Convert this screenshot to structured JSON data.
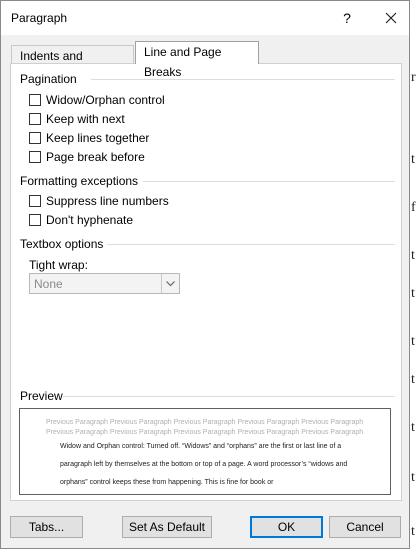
{
  "window": {
    "title": "Paragraph",
    "help_glyph": "?",
    "close_glyph": "✕"
  },
  "tabs": [
    {
      "label": "Indents and Spacing",
      "active": false
    },
    {
      "label": "Line and Page Breaks",
      "active": true
    }
  ],
  "pagination": {
    "heading": "Pagination",
    "options": [
      {
        "label": "Widow/Orphan control",
        "checked": false
      },
      {
        "label": "Keep with next",
        "checked": false
      },
      {
        "label": "Keep lines together",
        "checked": false
      },
      {
        "label": "Page break before",
        "checked": false
      }
    ]
  },
  "formatting_exceptions": {
    "heading": "Formatting exceptions",
    "options": [
      {
        "label": "Suppress line numbers",
        "checked": false
      },
      {
        "label": "Don't hyphenate",
        "checked": false
      }
    ]
  },
  "textbox_options": {
    "heading": "Textbox options",
    "tight_wrap_label": "Tight wrap:",
    "tight_wrap_value": "None",
    "dropdown_icon": "chevron-down-icon"
  },
  "preview": {
    "heading": "Preview",
    "previous_lines": [
      "Previous Paragraph Previous Paragraph Previous Paragraph Previous Paragraph Previous Paragraph",
      "Previous Paragraph Previous Paragraph Previous Paragraph Previous Paragraph Previous Paragraph"
    ],
    "text_lines": [
      "Widow and Orphan control: Turned off. “Widows” and “orphans” are the first or last line of a",
      "paragraph left by themselves at the bottom or top of a page. A word processor’s “widows and",
      "orphans” control keeps these from happening. This is fine for book or"
    ]
  },
  "buttons": {
    "tabs": "Tabs...",
    "set_as_default": "Set As Default",
    "ok": "OK",
    "cancel": "Cancel"
  },
  "background_chars": [
    "r",
    "t",
    "f",
    "t",
    "t",
    "t",
    "t",
    "t",
    "t",
    "t"
  ],
  "colors": {
    "accent": "#0078d7",
    "dialog_bg": "#f0f0f0",
    "panel_bg": "#ffffff"
  }
}
